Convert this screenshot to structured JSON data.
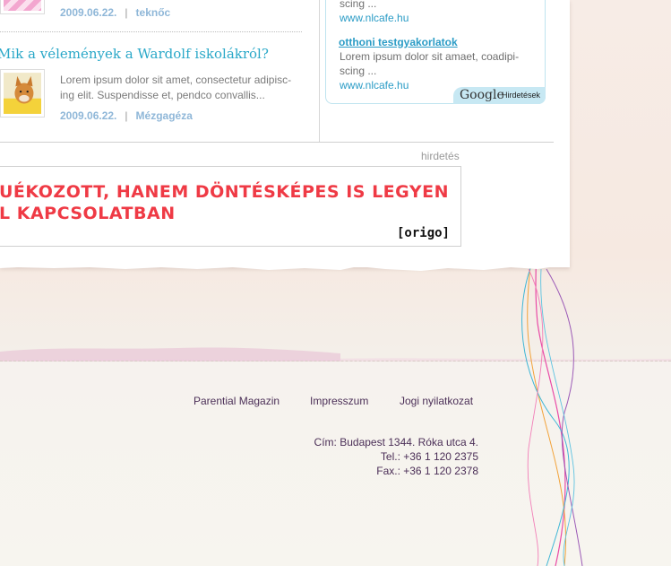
{
  "articles": [
    {
      "date": "2009.06.22.",
      "author": "teknőc"
    },
    {
      "title": "Mik a vélemények a Wardolf iskolákról?",
      "excerpt_line1": "Lorem ipsum dolor sit amet, consectetur adipisc-",
      "excerpt_line2": "ing elit. Suspendisse et, pendco convallis...",
      "date": "2009.06.22.",
      "author": "Mézgagéza"
    }
  ],
  "sidebar_ads": {
    "first": {
      "body_tail": "scing ...",
      "url": "www.nlcafe.hu"
    },
    "second": {
      "title": "otthoni testgyakorlatok",
      "body_line1": "Lorem ipsum dolor sit amaet, coadipi-",
      "body_line2": "scing ...",
      "url": "www.nlcafe.hu"
    },
    "google_logo": "Google",
    "google_label": "Hirdetések"
  },
  "banner": {
    "label": "hirdetés",
    "line1": "UÉKOZOTT, HANEM DÖNTÉSKÉPES IS LEGYEN",
    "line2": "L KAPCSOLATBAN",
    "brand": "[origo]"
  },
  "footer": {
    "links": [
      "Parential Magazin",
      "Impresszum",
      "Jogi nyilatkozat"
    ],
    "address": "Cím: Budapest 1344. Róka utca 4.",
    "phone": "Tel.: +36 1 120 2375",
    "fax": "Fax.: +36 1 120 2378"
  },
  "colors": {
    "link_blue": "#2aa8c8",
    "meta_blue": "#8fb7d8",
    "banner_red": "#ef3a45",
    "footer_purple": "#4b2f57"
  }
}
